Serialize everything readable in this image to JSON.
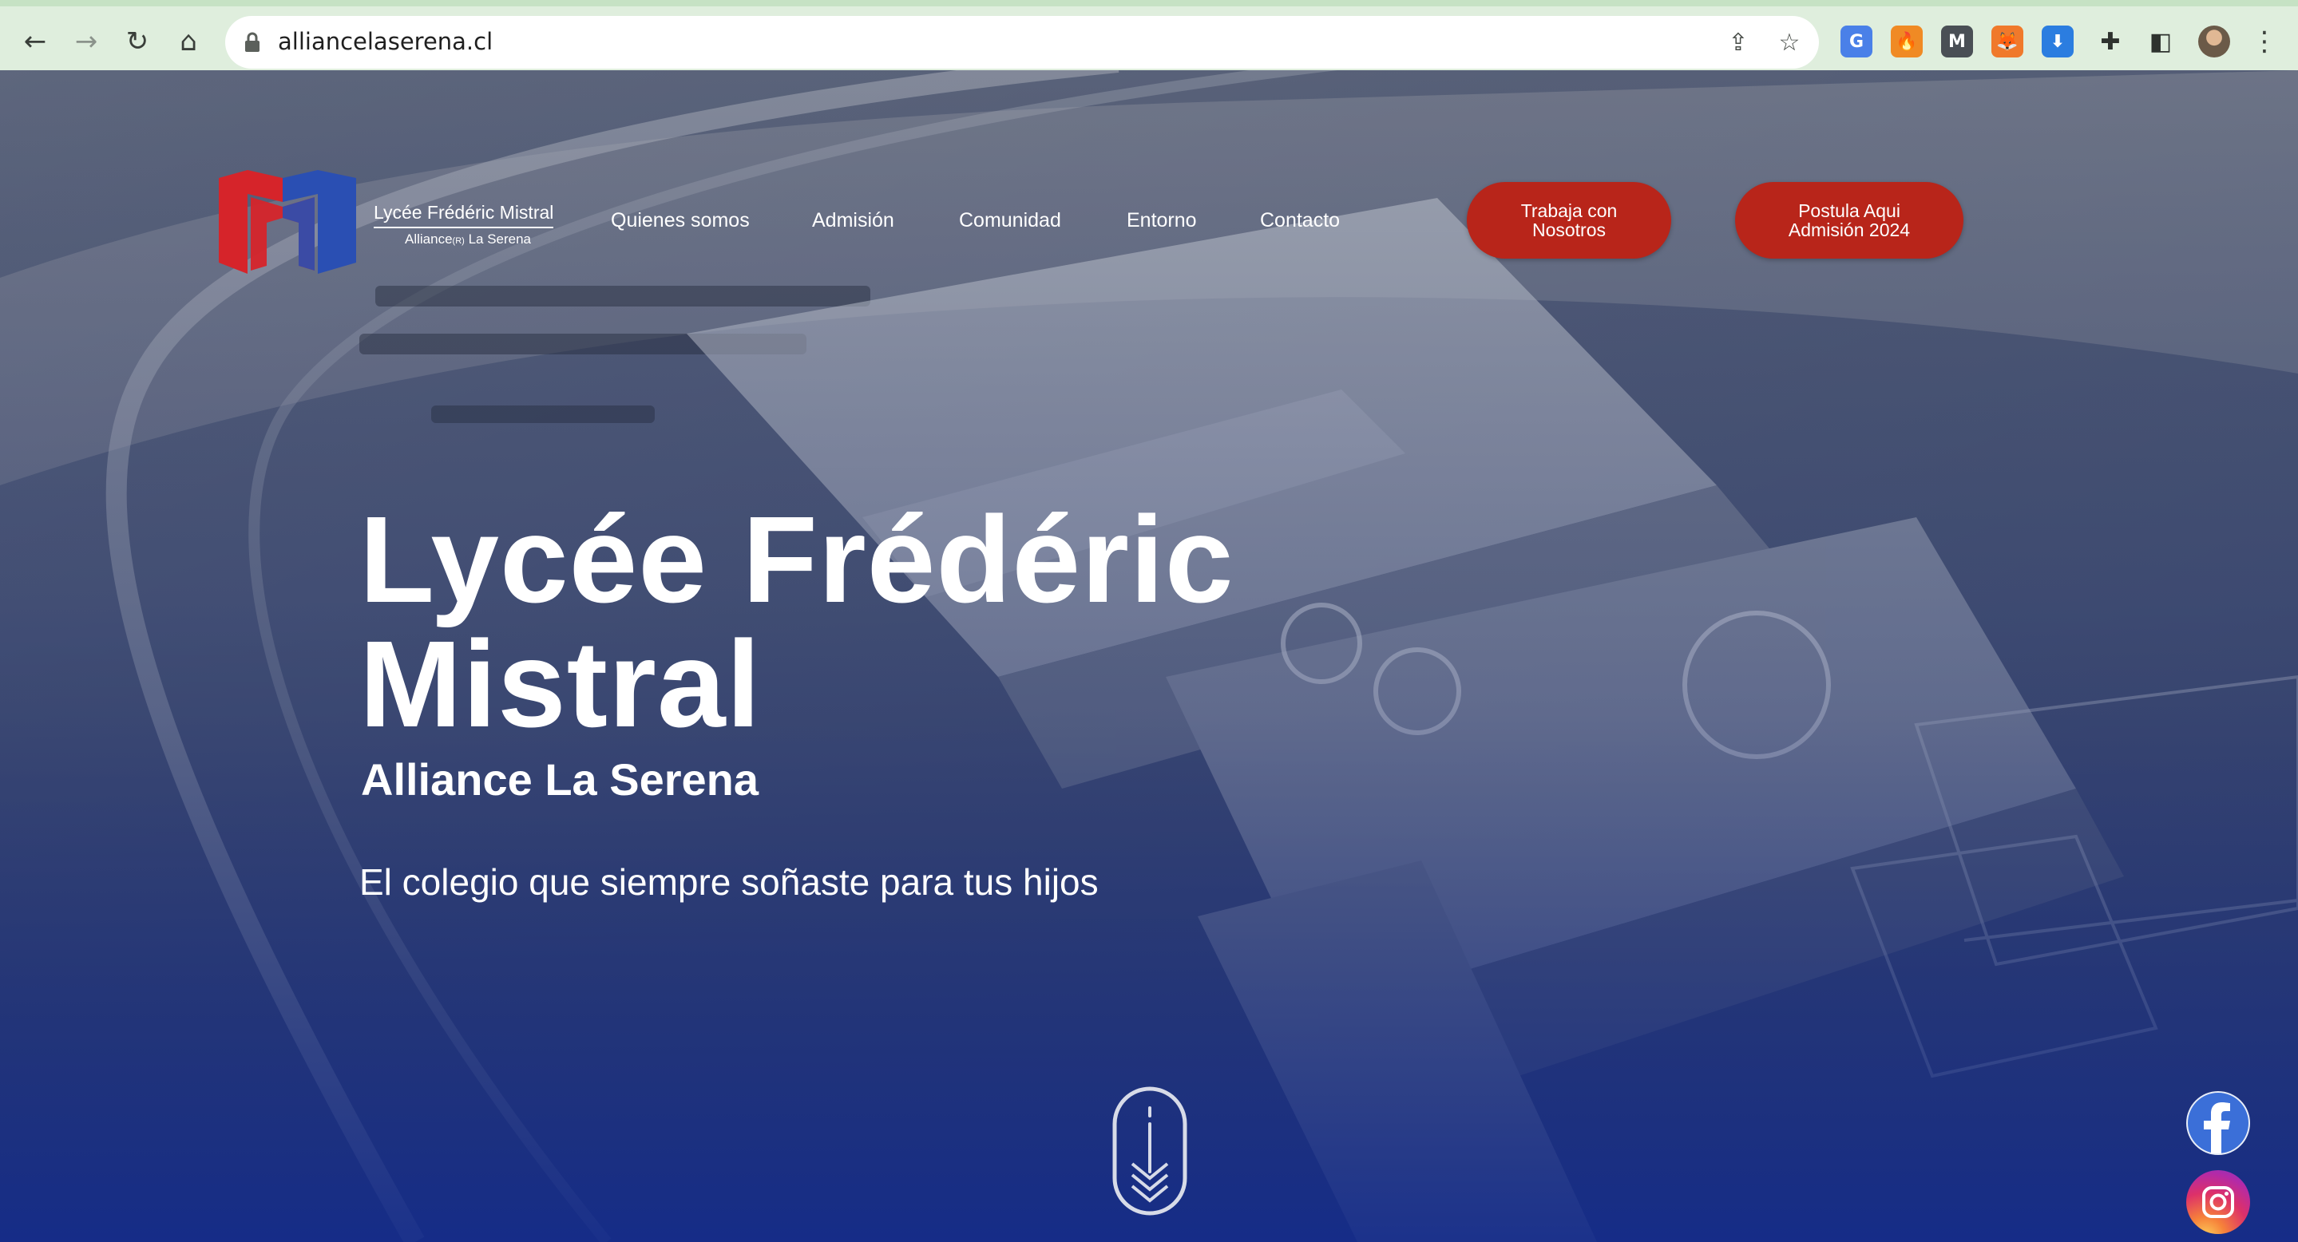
{
  "browser": {
    "url": "alliancelaserena.cl",
    "buttons": {
      "back": "←",
      "forward": "→",
      "reload": "↻",
      "home": "⌂",
      "share": "⇪",
      "bookmark": "☆",
      "menu": "⋮"
    },
    "extensions": [
      {
        "name": "translate-extension-icon",
        "glyph": "G",
        "color": "#4a80e8"
      },
      {
        "name": "fire-extension-icon",
        "glyph": "🔥",
        "color": "#f08a24"
      },
      {
        "name": "m-extension-icon",
        "glyph": "M",
        "color": "#4a4f55"
      },
      {
        "name": "fox-extension-icon",
        "glyph": "🦊",
        "color": "#f0792b"
      },
      {
        "name": "download-extension-icon",
        "glyph": "⬇",
        "color": "#2b7de0"
      },
      {
        "name": "puzzle-extensions-icon",
        "glyph": "✚",
        "color": "#2e322e"
      },
      {
        "name": "sidepanel-icon",
        "glyph": "◧",
        "color": "#2e322e"
      },
      {
        "name": "profile-avatar",
        "glyph": "",
        "color": "#6b5a48"
      }
    ]
  },
  "site": {
    "brand": {
      "title": "Lycée Frédéric Mistral",
      "subtitle": "Alliance",
      "subtitle_suffix": "La Serena"
    },
    "nav": [
      {
        "id": "quienes",
        "label": "Quienes somos"
      },
      {
        "id": "admision",
        "label": "Admisión"
      },
      {
        "id": "comunidad",
        "label": "Comunidad"
      },
      {
        "id": "entorno",
        "label": "Entorno"
      },
      {
        "id": "contacto",
        "label": "Contacto"
      }
    ],
    "cta_work": {
      "line1": "Trabaja con",
      "line2": "Nosotros"
    },
    "cta_apply": {
      "line1": "Postula Aqui",
      "line2": "Admisión 2024"
    },
    "hero": {
      "title_line1": "Lycée Frédéric",
      "title_line2": "Mistral",
      "subtitle": "Alliance La Serena",
      "tagline": "El colegio que siempre soñaste para tus hijos"
    },
    "colors": {
      "accent": "#b8251a",
      "logo_blue": "#2a4fb3",
      "logo_red": "#d6242a"
    }
  }
}
